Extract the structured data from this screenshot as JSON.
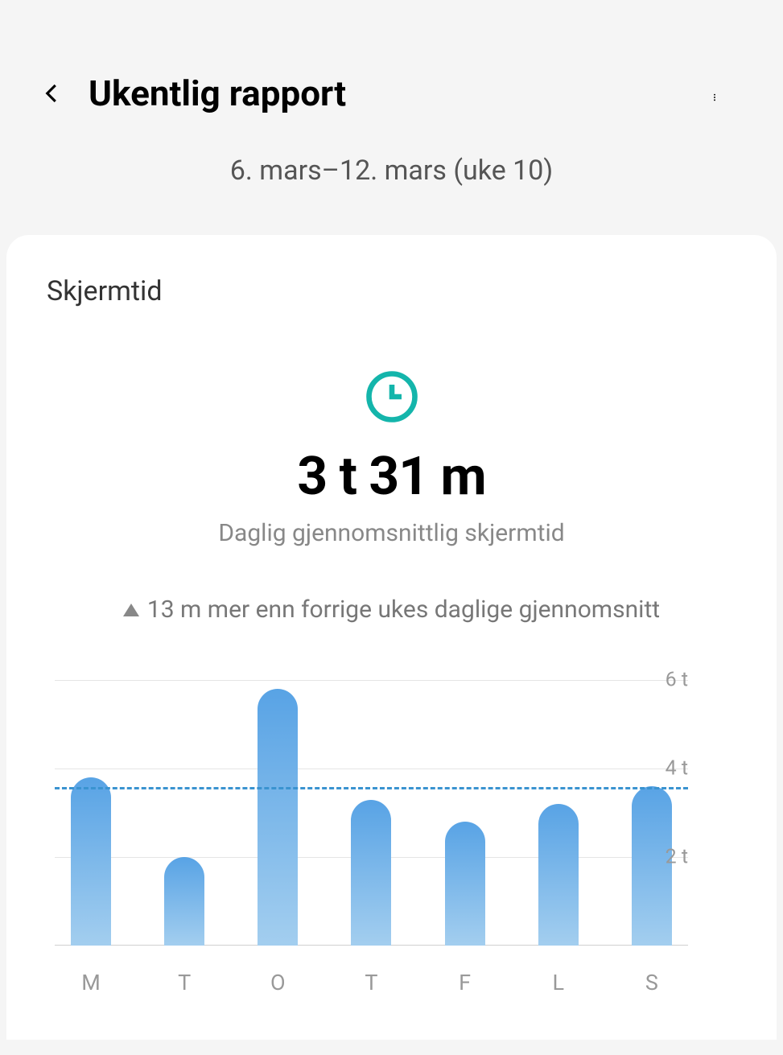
{
  "header": {
    "title": "Ukentlig rapport"
  },
  "date_range": "6. mars–12. mars (uke 10)",
  "section_title": "Skjermtid",
  "average_time": "3 t 31 m",
  "subtitle": "Daglig gjennomsnittlig skjermtid",
  "comparison": "13 m mer enn forrige ukes daglige gjennomsnitt",
  "chart_data": {
    "type": "bar",
    "categories": [
      "M",
      "T",
      "O",
      "T",
      "F",
      "L",
      "S"
    ],
    "values": [
      3.8,
      2.0,
      5.8,
      3.3,
      2.8,
      3.2,
      3.6
    ],
    "ylabel": "",
    "ylim": [
      0,
      6
    ],
    "y_ticks": [
      2,
      4,
      6
    ],
    "y_tick_labels": [
      "2 t",
      "4 t",
      "6 t"
    ],
    "average": 3.52
  },
  "colors": {
    "accent": "#14b5ab",
    "bar_top": "#58a3e5",
    "bar_bottom": "#a3ceef",
    "avg_line": "#3a93d0"
  }
}
